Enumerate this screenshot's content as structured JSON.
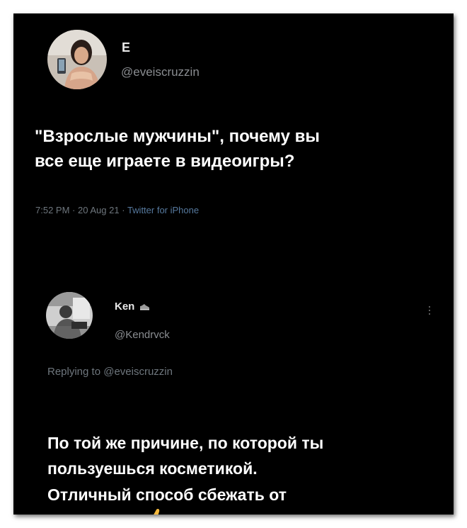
{
  "tweet": {
    "author_name": "E",
    "author_handle": "@eveiscruzzin",
    "avatar_icon": "profile-photo-woman",
    "text": "\"Взрослые мужчины\", почему вы\nвсе еще играете в видеоигры?",
    "time": "7:52 PM",
    "date": "20 Aug 21",
    "separator": "·",
    "source": "Twitter for iPhone"
  },
  "reply": {
    "author_name": "Ken",
    "name_emoji_icon": "sneaker-icon",
    "author_handle": "@Kendrvck",
    "avatar_icon": "profile-photo-man",
    "replying_prefix": "Replying to",
    "replying_handle": "@eveiscruzzin",
    "text": "По той же причине, по которой ты\nпользуешься косметикой.\nОтличный способ сбежать от\nреальности",
    "thumb_icon": "thumbs-up-icon",
    "more_icon": "more-options-icon"
  },
  "colors": {
    "background": "#000000",
    "text": "#ffffff",
    "secondary": "#8a8d91",
    "source_link": "#56799e",
    "thumb": "#f5b83d"
  }
}
